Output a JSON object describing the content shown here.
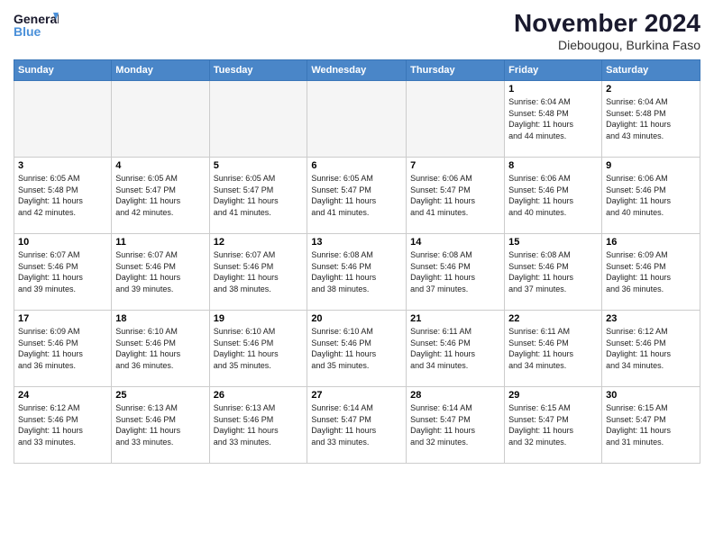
{
  "logo": {
    "line1": "General",
    "line2": "Blue"
  },
  "title": "November 2024",
  "subtitle": "Diebougou, Burkina Faso",
  "weekdays": [
    "Sunday",
    "Monday",
    "Tuesday",
    "Wednesday",
    "Thursday",
    "Friday",
    "Saturday"
  ],
  "weeks": [
    [
      {
        "day": "",
        "info": ""
      },
      {
        "day": "",
        "info": ""
      },
      {
        "day": "",
        "info": ""
      },
      {
        "day": "",
        "info": ""
      },
      {
        "day": "",
        "info": ""
      },
      {
        "day": "1",
        "info": "Sunrise: 6:04 AM\nSunset: 5:48 PM\nDaylight: 11 hours\nand 44 minutes."
      },
      {
        "day": "2",
        "info": "Sunrise: 6:04 AM\nSunset: 5:48 PM\nDaylight: 11 hours\nand 43 minutes."
      }
    ],
    [
      {
        "day": "3",
        "info": "Sunrise: 6:05 AM\nSunset: 5:48 PM\nDaylight: 11 hours\nand 42 minutes."
      },
      {
        "day": "4",
        "info": "Sunrise: 6:05 AM\nSunset: 5:47 PM\nDaylight: 11 hours\nand 42 minutes."
      },
      {
        "day": "5",
        "info": "Sunrise: 6:05 AM\nSunset: 5:47 PM\nDaylight: 11 hours\nand 41 minutes."
      },
      {
        "day": "6",
        "info": "Sunrise: 6:05 AM\nSunset: 5:47 PM\nDaylight: 11 hours\nand 41 minutes."
      },
      {
        "day": "7",
        "info": "Sunrise: 6:06 AM\nSunset: 5:47 PM\nDaylight: 11 hours\nand 41 minutes."
      },
      {
        "day": "8",
        "info": "Sunrise: 6:06 AM\nSunset: 5:46 PM\nDaylight: 11 hours\nand 40 minutes."
      },
      {
        "day": "9",
        "info": "Sunrise: 6:06 AM\nSunset: 5:46 PM\nDaylight: 11 hours\nand 40 minutes."
      }
    ],
    [
      {
        "day": "10",
        "info": "Sunrise: 6:07 AM\nSunset: 5:46 PM\nDaylight: 11 hours\nand 39 minutes."
      },
      {
        "day": "11",
        "info": "Sunrise: 6:07 AM\nSunset: 5:46 PM\nDaylight: 11 hours\nand 39 minutes."
      },
      {
        "day": "12",
        "info": "Sunrise: 6:07 AM\nSunset: 5:46 PM\nDaylight: 11 hours\nand 38 minutes."
      },
      {
        "day": "13",
        "info": "Sunrise: 6:08 AM\nSunset: 5:46 PM\nDaylight: 11 hours\nand 38 minutes."
      },
      {
        "day": "14",
        "info": "Sunrise: 6:08 AM\nSunset: 5:46 PM\nDaylight: 11 hours\nand 37 minutes."
      },
      {
        "day": "15",
        "info": "Sunrise: 6:08 AM\nSunset: 5:46 PM\nDaylight: 11 hours\nand 37 minutes."
      },
      {
        "day": "16",
        "info": "Sunrise: 6:09 AM\nSunset: 5:46 PM\nDaylight: 11 hours\nand 36 minutes."
      }
    ],
    [
      {
        "day": "17",
        "info": "Sunrise: 6:09 AM\nSunset: 5:46 PM\nDaylight: 11 hours\nand 36 minutes."
      },
      {
        "day": "18",
        "info": "Sunrise: 6:10 AM\nSunset: 5:46 PM\nDaylight: 11 hours\nand 36 minutes."
      },
      {
        "day": "19",
        "info": "Sunrise: 6:10 AM\nSunset: 5:46 PM\nDaylight: 11 hours\nand 35 minutes."
      },
      {
        "day": "20",
        "info": "Sunrise: 6:10 AM\nSunset: 5:46 PM\nDaylight: 11 hours\nand 35 minutes."
      },
      {
        "day": "21",
        "info": "Sunrise: 6:11 AM\nSunset: 5:46 PM\nDaylight: 11 hours\nand 34 minutes."
      },
      {
        "day": "22",
        "info": "Sunrise: 6:11 AM\nSunset: 5:46 PM\nDaylight: 11 hours\nand 34 minutes."
      },
      {
        "day": "23",
        "info": "Sunrise: 6:12 AM\nSunset: 5:46 PM\nDaylight: 11 hours\nand 34 minutes."
      }
    ],
    [
      {
        "day": "24",
        "info": "Sunrise: 6:12 AM\nSunset: 5:46 PM\nDaylight: 11 hours\nand 33 minutes."
      },
      {
        "day": "25",
        "info": "Sunrise: 6:13 AM\nSunset: 5:46 PM\nDaylight: 11 hours\nand 33 minutes."
      },
      {
        "day": "26",
        "info": "Sunrise: 6:13 AM\nSunset: 5:46 PM\nDaylight: 11 hours\nand 33 minutes."
      },
      {
        "day": "27",
        "info": "Sunrise: 6:14 AM\nSunset: 5:47 PM\nDaylight: 11 hours\nand 33 minutes."
      },
      {
        "day": "28",
        "info": "Sunrise: 6:14 AM\nSunset: 5:47 PM\nDaylight: 11 hours\nand 32 minutes."
      },
      {
        "day": "29",
        "info": "Sunrise: 6:15 AM\nSunset: 5:47 PM\nDaylight: 11 hours\nand 32 minutes."
      },
      {
        "day": "30",
        "info": "Sunrise: 6:15 AM\nSunset: 5:47 PM\nDaylight: 11 hours\nand 31 minutes."
      }
    ]
  ]
}
